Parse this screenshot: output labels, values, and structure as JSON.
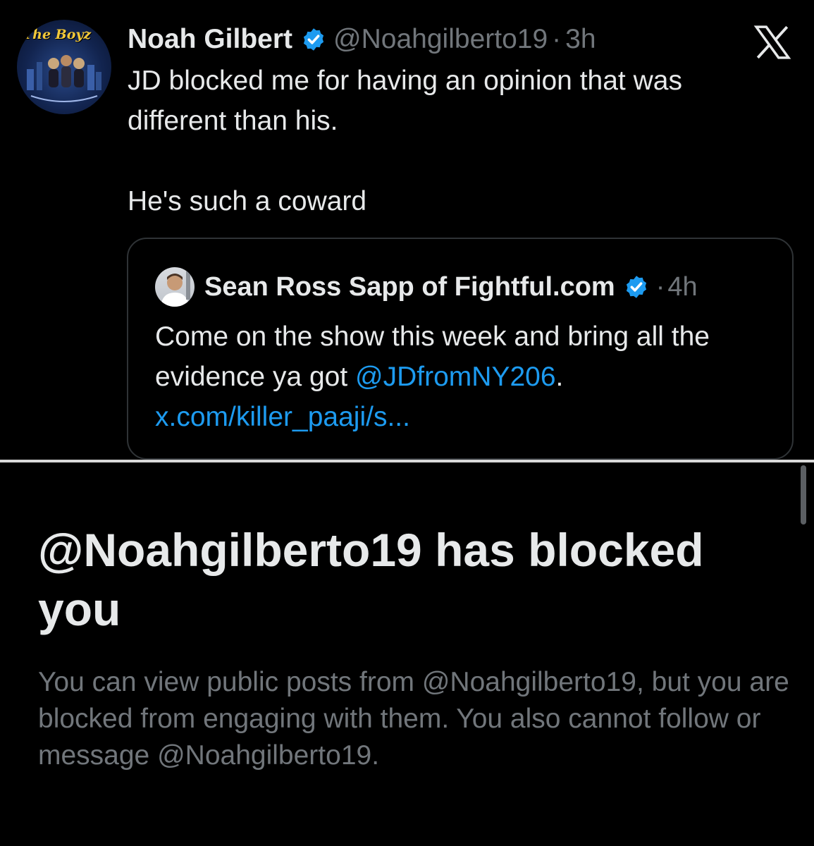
{
  "tweet": {
    "avatar_text": "The Boyz",
    "author_name": "Noah Gilbert",
    "author_handle": "@Noahgilberto19",
    "separator": "·",
    "time": "3h",
    "text_line1": "JD blocked me for having an opinion that was different than his.",
    "text_line2": "He's such a coward",
    "quote": {
      "author_name": "Sean Ross Sapp of Fightful.com",
      "separator": "·",
      "time": "4h",
      "text_before": "Come on the show this week and bring all the evidence ya got ",
      "mention": "@JDfromNY206",
      "text_after": ". ",
      "link": "x.com/killer_paaji/s..."
    }
  },
  "block_notice": {
    "title": "@Noahgilberto19 has blocked you",
    "description": "You can view public posts from @Noahgilberto19, but you are blocked from engaging with them. You also cannot follow or message @Noahgilberto19."
  },
  "icons": {
    "verified": "verified-badge-icon",
    "brand": "x-logo-icon"
  },
  "colors": {
    "background": "#000000",
    "text_primary": "#e7e9ea",
    "text_secondary": "#71767b",
    "accent": "#1d9bf0",
    "border": "#2f3336"
  }
}
